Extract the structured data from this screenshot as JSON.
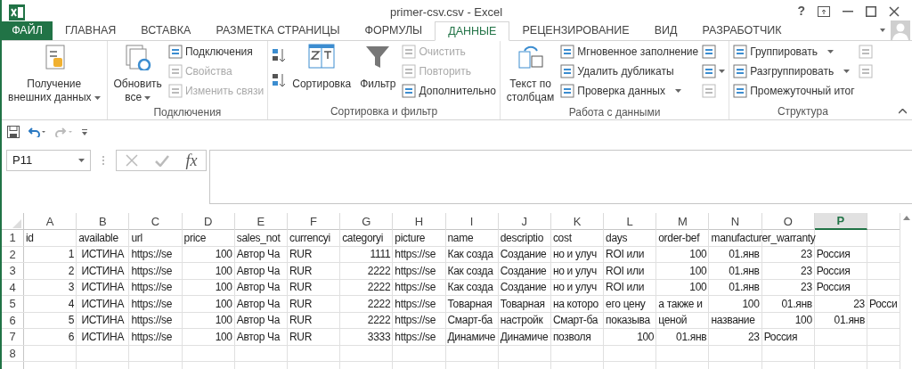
{
  "window": {
    "title": "primer-csv.csv - Excel",
    "help": "?"
  },
  "formula_bar": {
    "function_button": "fx"
  },
  "tabs": [
    {
      "label": "ФАЙЛ",
      "kind": "file",
      "selected": false
    },
    {
      "label": "ГЛАВНАЯ",
      "kind": "tab",
      "selected": false
    },
    {
      "label": "ВСТАВКА",
      "kind": "tab",
      "selected": false
    },
    {
      "label": "РАЗМЕТКА СТРАНИЦЫ",
      "kind": "tab",
      "selected": false
    },
    {
      "label": "ФОРМУЛЫ",
      "kind": "tab",
      "selected": false
    },
    {
      "label": "ДАННЫЕ",
      "kind": "tab",
      "selected": true
    },
    {
      "label": "РЕЦЕНЗИРОВАНИЕ",
      "kind": "tab",
      "selected": false
    },
    {
      "label": "ВИД",
      "kind": "tab",
      "selected": false
    },
    {
      "label": "РАЗРАБОТЧИК",
      "kind": "tab",
      "selected": false
    }
  ],
  "ribbon": {
    "groups": [
      {
        "items": [
          {
            "kind": "big",
            "lines": [
              "Получение",
              "внешних данных"
            ],
            "dropdown": true,
            "disabled": false
          }
        ]
      },
      {
        "label": "Подключения",
        "items": [
          {
            "kind": "big",
            "lines": [
              "Обновить",
              "все"
            ],
            "dropdown": true,
            "disabled": false
          },
          {
            "kind": "small",
            "label": "Подключения",
            "disabled": false
          },
          {
            "kind": "small",
            "label": "Свойства",
            "disabled": true
          },
          {
            "kind": "small",
            "label": "Изменить связи",
            "disabled": true
          }
        ]
      },
      {
        "label": "Сортировка и фильтр",
        "items": [
          {
            "kind": "sort",
            "disabled": false
          },
          {
            "kind": "big",
            "lines": [
              "Сортировка"
            ],
            "dropdown": false,
            "disabled": false
          },
          {
            "kind": "big",
            "lines": [
              "Фильтр"
            ],
            "dropdown": false,
            "disabled": false
          },
          {
            "kind": "small",
            "label": "Очистить",
            "disabled": true
          },
          {
            "kind": "small",
            "label": "Повторить",
            "disabled": true
          },
          {
            "kind": "small",
            "label": "Дополнительно",
            "disabled": false
          }
        ]
      },
      {
        "label": "Работа с данными",
        "items": [
          {
            "kind": "big",
            "lines": [
              "Текст по",
              "столбцам"
            ],
            "dropdown": false,
            "disabled": false
          },
          {
            "kind": "small",
            "label": "Мгновенное заполнение",
            "disabled": false
          },
          {
            "kind": "small",
            "label": "Удалить дубликаты",
            "disabled": false
          },
          {
            "kind": "small",
            "label": "Проверка данных",
            "dropdown": true,
            "disabled": false
          },
          {
            "kind": "icon",
            "disabled": false
          },
          {
            "kind": "icon",
            "dropdown": true,
            "disabled": false
          },
          {
            "kind": "icon",
            "disabled": true
          }
        ]
      },
      {
        "label": "Структура",
        "items": [
          {
            "kind": "small",
            "label": "Группировать",
            "dropdown": true,
            "disabled": false
          },
          {
            "kind": "small",
            "label": "Разгруппировать",
            "dropdown": true,
            "disabled": false
          },
          {
            "kind": "small",
            "label": "Промежуточный итог",
            "disabled": false
          },
          {
            "kind": "icon",
            "disabled": true
          },
          {
            "kind": "icon",
            "disabled": true
          }
        ]
      }
    ]
  },
  "name_box": "P11",
  "sheet": {
    "columns": [
      {
        "label": "A",
        "selected": false
      },
      {
        "label": "B",
        "selected": false
      },
      {
        "label": "C",
        "selected": false
      },
      {
        "label": "D",
        "selected": false
      },
      {
        "label": "E",
        "selected": false
      },
      {
        "label": "F",
        "selected": false
      },
      {
        "label": "G",
        "selected": false
      },
      {
        "label": "H",
        "selected": false
      },
      {
        "label": "I",
        "selected": false
      },
      {
        "label": "J",
        "selected": false
      },
      {
        "label": "K",
        "selected": false
      },
      {
        "label": "L",
        "selected": false
      },
      {
        "label": "M",
        "selected": false
      },
      {
        "label": "N",
        "selected": false
      },
      {
        "label": "O",
        "selected": false
      },
      {
        "label": "P",
        "selected": true
      }
    ],
    "rows": [
      {
        "number": "1",
        "cells": [
          {
            "text": "id"
          },
          {
            "text": "available"
          },
          {
            "text": "url"
          },
          {
            "text": "price"
          },
          {
            "text": "sales_not"
          },
          {
            "text": "currencyi"
          },
          {
            "text": "categoryi"
          },
          {
            "text": "picture"
          },
          {
            "text": "name"
          },
          {
            "text": "descriptio"
          },
          {
            "text": "cost"
          },
          {
            "text": "days"
          },
          {
            "text": "order-bef"
          },
          {
            "text": "manufacturer_warranty"
          }
        ]
      },
      {
        "number": "2",
        "cells": [
          {
            "text": "1",
            "kind": "number"
          },
          {
            "text": "ИСТИНА",
            "kind": "center"
          },
          {
            "text": "https://se"
          },
          {
            "text": "100",
            "kind": "number"
          },
          {
            "text": "Автор Ча"
          },
          {
            "text": "RUR"
          },
          {
            "text": "1111",
            "kind": "number"
          },
          {
            "text": "https://se"
          },
          {
            "text": "Как созда"
          },
          {
            "text": "Создание"
          },
          {
            "text": "но и улуч"
          },
          {
            "text": "ROI или"
          },
          {
            "text": "100",
            "kind": "number"
          },
          {
            "text": "01.янв",
            "kind": "number"
          },
          {
            "text": "23",
            "kind": "number"
          },
          {
            "text": "Россия"
          }
        ]
      },
      {
        "number": "3",
        "cells": [
          {
            "text": "2",
            "kind": "number"
          },
          {
            "text": "ИСТИНА",
            "kind": "center"
          },
          {
            "text": "https://se"
          },
          {
            "text": "100",
            "kind": "number"
          },
          {
            "text": "Автор Ча"
          },
          {
            "text": "RUR"
          },
          {
            "text": "2222",
            "kind": "number"
          },
          {
            "text": "https://se"
          },
          {
            "text": "Как созда"
          },
          {
            "text": "Создание"
          },
          {
            "text": "но и улуч"
          },
          {
            "text": "ROI или"
          },
          {
            "text": "100",
            "kind": "number"
          },
          {
            "text": "01.янв",
            "kind": "number"
          },
          {
            "text": "23",
            "kind": "number"
          },
          {
            "text": "Россия"
          }
        ]
      },
      {
        "number": "4",
        "cells": [
          {
            "text": "3",
            "kind": "number"
          },
          {
            "text": "ИСТИНА",
            "kind": "center"
          },
          {
            "text": "https://se"
          },
          {
            "text": "100",
            "kind": "number"
          },
          {
            "text": "Автор Ча"
          },
          {
            "text": "RUR"
          },
          {
            "text": "2222",
            "kind": "number"
          },
          {
            "text": "https://se"
          },
          {
            "text": "Как созда"
          },
          {
            "text": "Создание"
          },
          {
            "text": "но и улуч"
          },
          {
            "text": "ROI или"
          },
          {
            "text": "100",
            "kind": "number"
          },
          {
            "text": "01.янв",
            "kind": "number"
          },
          {
            "text": "23",
            "kind": "number"
          },
          {
            "text": "Россия"
          }
        ]
      },
      {
        "number": "5",
        "cells": [
          {
            "text": "4",
            "kind": "number"
          },
          {
            "text": "ИСТИНА",
            "kind": "center"
          },
          {
            "text": "https://se"
          },
          {
            "text": "100",
            "kind": "number"
          },
          {
            "text": "Автор Ча"
          },
          {
            "text": "RUR"
          },
          {
            "text": "2222",
            "kind": "number"
          },
          {
            "text": "https://se"
          },
          {
            "text": "Товарная"
          },
          {
            "text": "Товарная"
          },
          {
            "text": "на которо"
          },
          {
            "text": "его цену"
          },
          {
            "text": "а также и"
          },
          {
            "text": "100",
            "kind": "number"
          },
          {
            "text": "01.янв",
            "kind": "number"
          },
          {
            "text": "23",
            "kind": "number"
          },
          {
            "text": "Росси"
          }
        ]
      },
      {
        "number": "6",
        "cells": [
          {
            "text": "5",
            "kind": "number"
          },
          {
            "text": "ИСТИНА",
            "kind": "center"
          },
          {
            "text": "https://se"
          },
          {
            "text": "100",
            "kind": "number"
          },
          {
            "text": "Автор Ча"
          },
          {
            "text": "RUR"
          },
          {
            "text": "2222",
            "kind": "number"
          },
          {
            "text": "https://se"
          },
          {
            "text": "Смарт-ба"
          },
          {
            "text": "настройк"
          },
          {
            "text": "Смарт-ба"
          },
          {
            "text": "показыва"
          },
          {
            "text": "ценой"
          },
          {
            "text": "название"
          },
          {
            "text": "100",
            "kind": "number"
          },
          {
            "text": "01.янв",
            "kind": "number"
          }
        ]
      },
      {
        "number": "7",
        "cells": [
          {
            "text": "6",
            "kind": "number"
          },
          {
            "text": "ИСТИНА",
            "kind": "center"
          },
          {
            "text": "https://se"
          },
          {
            "text": "100",
            "kind": "number"
          },
          {
            "text": "Автор Ча"
          },
          {
            "text": "RUR"
          },
          {
            "text": "3333",
            "kind": "number"
          },
          {
            "text": "https://se"
          },
          {
            "text": "Динамиче"
          },
          {
            "text": "Динамиче"
          },
          {
            "text": "позволя"
          },
          {
            "text": "100",
            "kind": "number"
          },
          {
            "text": "01.янв",
            "kind": "number"
          },
          {
            "text": "23",
            "kind": "number"
          },
          {
            "text": "Россия"
          }
        ]
      },
      {
        "number": "8",
        "cells": []
      }
    ]
  }
}
